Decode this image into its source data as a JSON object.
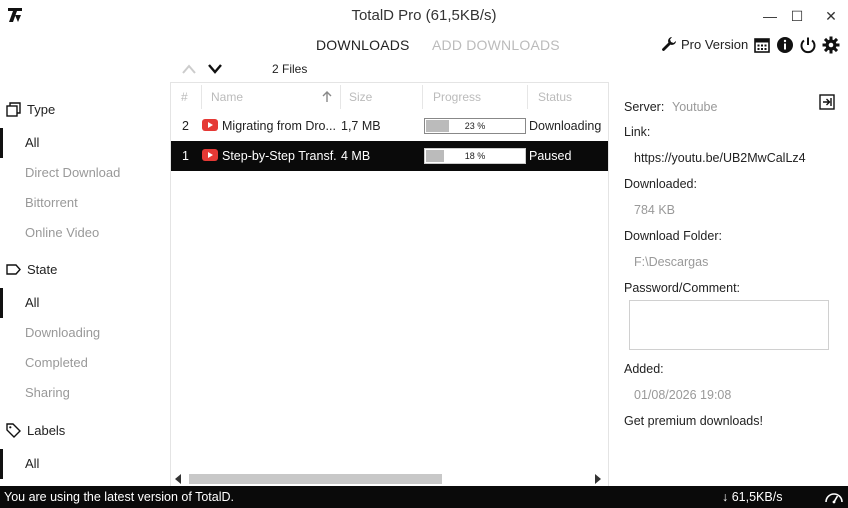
{
  "window": {
    "title": "TotalD Pro (61,5KB/s)",
    "minimize_glyph": "—",
    "maximize_glyph": "☐",
    "close_glyph": "✕"
  },
  "header": {
    "tabs": [
      {
        "label": "DOWNLOADS",
        "active": true
      },
      {
        "label": "ADD DOWNLOADS",
        "active": false
      }
    ],
    "pro_version_label": "Pro Version",
    "icons": [
      "calendar-icon",
      "info-icon",
      "power-icon",
      "gear-icon"
    ]
  },
  "toolbar": {
    "files_count": "2 Files"
  },
  "sidebar": {
    "type": {
      "heading": "Type",
      "items": [
        {
          "label": "All",
          "active": true
        },
        {
          "label": "Direct Download",
          "active": false
        },
        {
          "label": "Bittorrent",
          "active": false
        },
        {
          "label": "Online Video",
          "active": false
        }
      ]
    },
    "state": {
      "heading": "State",
      "items": [
        {
          "label": "All",
          "active": true
        },
        {
          "label": "Downloading",
          "active": false
        },
        {
          "label": "Completed",
          "active": false
        },
        {
          "label": "Sharing",
          "active": false
        }
      ]
    },
    "labels": {
      "heading": "Labels",
      "items": [
        {
          "label": "All",
          "active": true
        }
      ]
    }
  },
  "table": {
    "columns": [
      "#",
      "Name",
      "Size",
      "Progress",
      "Status"
    ],
    "rows": [
      {
        "num": "2",
        "name": "Migrating from Dro...",
        "size": "1,7 MB",
        "progress": 23,
        "progress_label": "23 %",
        "status": "Downloading",
        "selected": false
      },
      {
        "num": "1",
        "name": "Step-by-Step Transf...",
        "size": "4 MB",
        "progress": 18,
        "progress_label": "18 %",
        "status": "Paused",
        "selected": true
      }
    ]
  },
  "details": {
    "server_label": "Server:",
    "server_value": "Youtube",
    "link_label": "Link:",
    "link_value": "https://youtu.be/UB2MwCalLz4",
    "downloaded_label": "Downloaded:",
    "downloaded_value": "784 KB",
    "folder_label": "Download Folder:",
    "folder_value": "F:\\Descargas",
    "comment_label": "Password/Comment:",
    "comment_value": "",
    "added_label": "Added:",
    "added_value": "01/08/2026 19:08",
    "premium_link": "Get premium downloads!"
  },
  "statusbar": {
    "message": "You are using the latest version of TotalD.",
    "speed": "↓ 61,5KB/s"
  },
  "colors": {
    "accent_dark": "#0a0a0a",
    "youtube_red": "#e53935",
    "muted_text": "#999999"
  }
}
